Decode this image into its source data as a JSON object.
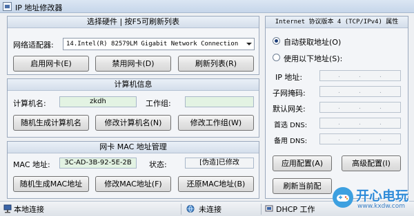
{
  "window": {
    "title": "IP 地址修改器"
  },
  "adapter_panel": {
    "header": "选择硬件 | 按F5可刷新列表",
    "adapter_label": "网络适配器:",
    "adapter_value": "14.Intel(R) 82579LM Gigabit Network Connection",
    "enable_button": "启用网卡(E)",
    "disable_button": "禁用网卡(D)",
    "refresh_button": "刷新列表(R)"
  },
  "computer_panel": {
    "header": "计算机信息",
    "name_label": "计算机名:",
    "name_value": "zkdh",
    "workgroup_label": "工作组:",
    "workgroup_value": "",
    "random_button": "随机生成计算机名",
    "modify_name_button": "修改计算机名(N)",
    "modify_workgroup_button": "修改工作组(W)"
  },
  "mac_panel": {
    "header": "网卡 MAC 地址管理",
    "mac_label": "MAC 地址:",
    "mac_value": "3C-AD-3B-92-5E-2B",
    "status_label": "状态:",
    "status_value": "[伪造]已修改",
    "random_button": "随机生成MAC地址",
    "modify_button": "修改MAC地址(F)",
    "restore_button": "还原MAC地址(B)"
  },
  "ipv4_panel": {
    "header": "Internet 协议版本 4 (TCP/IPv4) 属性",
    "auto_option": "自动获取地址(O)",
    "manual_option": "使用以下地址(S):",
    "ip_label": "IP 地址:",
    "mask_label": "子网掩码:",
    "gateway_label": "默认网关:",
    "dns1_label": "首选 DNS:",
    "dns2_label": "备用 DNS:",
    "apply_button": "应用配置(A)",
    "advanced_button": "高级配置(I)",
    "refresh_button": "刷新当前配",
    "selected_option": "auto"
  },
  "statusbar": {
    "connection": "本地连接",
    "link_state": "未连接",
    "dhcp": "DHCP 工作"
  },
  "watermark": {
    "brand": "开心电玩",
    "url": "www.kxdw.com"
  },
  "colors": {
    "field_bg": "#e3f3e3",
    "panel_header": "#d4deeb",
    "window_bg": "#eef0f3"
  }
}
